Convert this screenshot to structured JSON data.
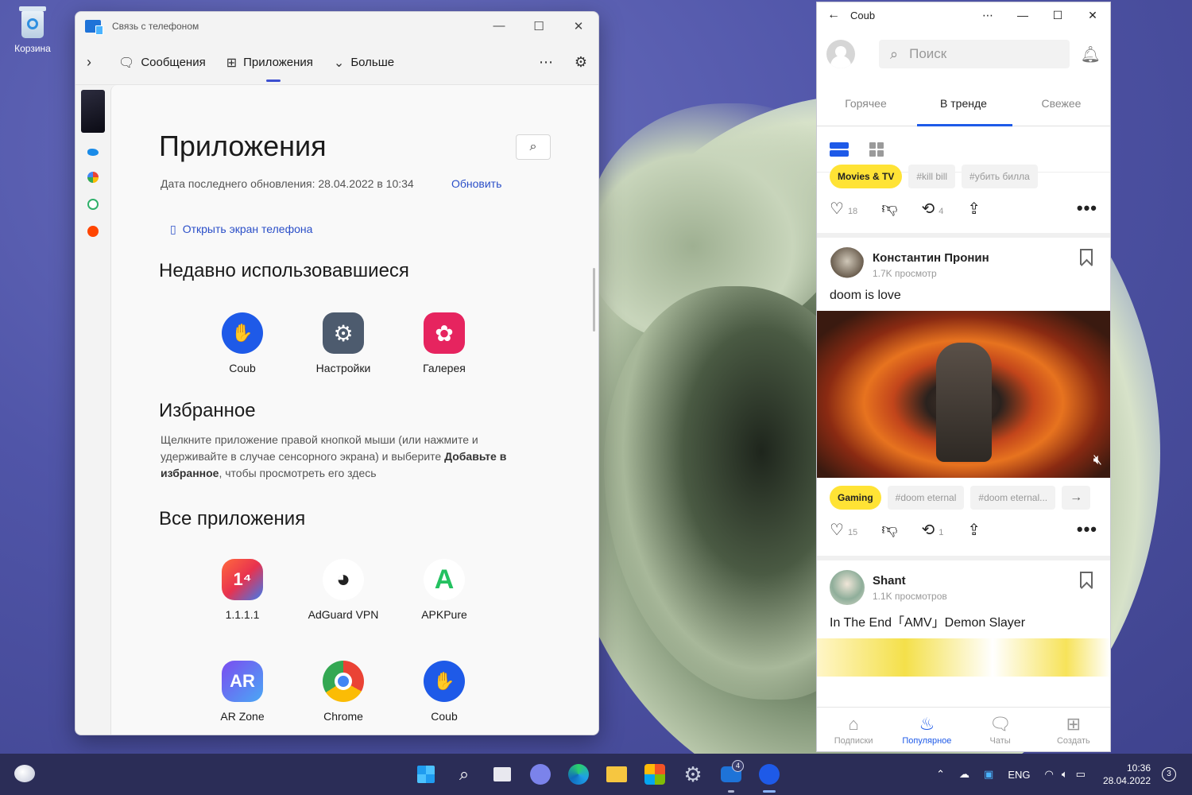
{
  "desktop": {
    "recycle_bin_label": "Корзина"
  },
  "phone_link": {
    "window_title": "Связь с телефоном",
    "nav": {
      "messages": "Сообщения",
      "apps": "Приложения",
      "more": "Больше",
      "overflow": "⋯",
      "settings": "⚙"
    },
    "heading": "Приложения",
    "last_update": "Дата последнего обновления: 28.04.2022 в 10:34",
    "refresh_label": "Обновить",
    "open_phone_screen": "Открыть экран телефона",
    "recent_title": "Недавно использовавшиеся",
    "recent_apps": [
      {
        "name": "Coub",
        "color": "#1e5ae8"
      },
      {
        "name": "Настройки",
        "color": "#4d5b6e"
      },
      {
        "name": "Галерея",
        "color": "#e6245f"
      }
    ],
    "favorites_title": "Избранное",
    "favorites_desc_1": "Щелкните приложение правой кнопкой мыши (или нажмите и удерживайте в случае сенсорного экрана) и выберите ",
    "favorites_desc_bold": "Добавьте в избранное",
    "favorites_desc_2": ", чтобы просмотреть его здесь",
    "all_title": "Все приложения",
    "all_apps": [
      {
        "name": "1.1.1.1",
        "icon_text": "1⁴",
        "color": "#e9503a"
      },
      {
        "name": "AdGuard VPN",
        "icon_text": "◕",
        "color": "#ffffff"
      },
      {
        "name": "APKPure",
        "icon_text": "A",
        "color": "#ffffff"
      },
      {
        "name": "AR Zone",
        "icon_text": "AR",
        "color": "#6a4fe0"
      },
      {
        "name": "Chrome",
        "icon_text": "",
        "color": "#ffffff"
      },
      {
        "name": "Coub",
        "icon_text": "",
        "color": "#1e5ae8"
      }
    ]
  },
  "coub": {
    "window_title": "Coub",
    "search_placeholder": "Поиск",
    "tabs": [
      "Горячее",
      "В тренде",
      "Свежее"
    ],
    "active_tab": "В тренде",
    "post0": {
      "tags": [
        "Movies & TV",
        "#kill bill",
        "#убить билла"
      ],
      "likes": "18",
      "recoubs": "4"
    },
    "post1": {
      "author": "Константин Пронин",
      "views": "1.7K просмотр",
      "caption": "doom is love",
      "tags": [
        "Gaming",
        "#doom eternal",
        "#doom eternal..."
      ],
      "likes": "15",
      "recoubs": "1"
    },
    "post2": {
      "author": "Shant",
      "views": "1.1K просмотров",
      "caption": "In The End「AMV」Demon Slayer"
    },
    "bottom_nav": [
      "Подписки",
      "Популярное",
      "Чаты",
      "Создать"
    ],
    "accent": "#1e5ae8",
    "tag_highlight": "#ffe335"
  },
  "taskbar": {
    "phone_link_badge": "4",
    "language": "ENG",
    "time": "10:36",
    "date": "28.04.2022",
    "notifications": "3"
  }
}
